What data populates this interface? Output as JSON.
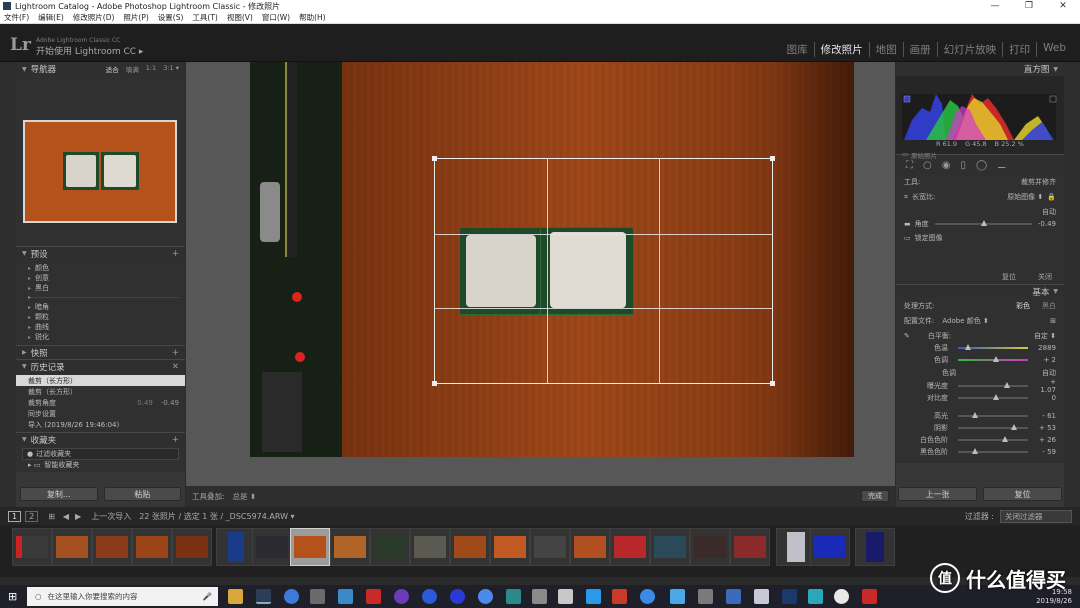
{
  "window": {
    "title": "Lightroom Catalog - Adobe Photoshop Lightroom Classic - 修改照片",
    "controls": [
      "—",
      "❐",
      "✕"
    ]
  },
  "menu": [
    "文件(F)",
    "编辑(E)",
    "修改照片(D)",
    "照片(P)",
    "设置(S)",
    "工具(T)",
    "视图(V)",
    "窗口(W)",
    "帮助(H)"
  ],
  "identity": {
    "logo": "Lr",
    "sub": "Adobe Lightroom Classic CC",
    "main": "开始使用 Lightroom CC ▸"
  },
  "modules": [
    "图库",
    "修改照片",
    "地图",
    "画册",
    "幻灯片放映",
    "打印",
    "Web"
  ],
  "active_module": "修改照片",
  "left": {
    "navigator": {
      "title": "导航器",
      "opts": [
        "适合",
        "填满",
        "1:1",
        "3:1 ▾"
      ]
    },
    "presets": {
      "title": "预设",
      "groups_a": [
        "颜色",
        "创意",
        "黑白"
      ],
      "groups_b": [
        "暗角",
        "颗粒",
        "曲线",
        "锐化"
      ]
    },
    "snapshots": {
      "title": "快照"
    },
    "history": {
      "title": "历史记录",
      "items": [
        {
          "label": "裁剪（长方形）",
          "a": "",
          "b": ""
        },
        {
          "label": "裁剪（长方形）",
          "a": "",
          "b": ""
        },
        {
          "label": "裁剪角度",
          "a": "0.49",
          "b": "-0.49"
        },
        {
          "label": "同步设置",
          "a": "",
          "b": ""
        },
        {
          "label": "导入 (2019/8/26 19:46:04)",
          "a": "",
          "b": ""
        }
      ]
    },
    "collections": {
      "title": "收藏夹",
      "filter": "过滤收藏夹",
      "smart": "智能收藏夹"
    },
    "copy_btn": "复制...",
    "paste_btn": "粘贴"
  },
  "toolbar": {
    "label": "工具叠加:",
    "value": "总是 ⬍",
    "done": "完成"
  },
  "right": {
    "histogram": {
      "title": "直方图",
      "r": "R 61.9",
      "g": "G 45.8",
      "b": "B 25.2 %",
      "orig": "原始照片"
    },
    "crop": {
      "tool_label": "工具:",
      "tool_value": "裁剪并修齐",
      "aspect_label": "长宽比:",
      "aspect_value": "原始图像 ⬍",
      "auto": "自动",
      "angle_label": "角度",
      "angle_value": "-0.49",
      "lock": "锁定图像",
      "reset": "复位",
      "close": "关闭"
    },
    "basic": {
      "title": "基本",
      "treat_label": "处理方式:",
      "treat_color": "彩色",
      "treat_bw": "黑白",
      "profile_label": "配置文件:",
      "profile_value": "Adobe 颜色 ⬍",
      "wb_label": "白平衡:",
      "wb_value": "自定 ⬍",
      "temp_label": "色温",
      "temp_value": "2889",
      "tint_label": "色调",
      "tint_value": "+ 2",
      "tone_label": "色调",
      "tone_auto": "自动",
      "sliders": [
        {
          "k": "曝光度",
          "v": "+ 1.07",
          "pos": 0.66
        },
        {
          "k": "对比度",
          "v": "0",
          "pos": 0.5
        },
        {
          "k": "高光",
          "v": "- 61",
          "pos": 0.2
        },
        {
          "k": "阴影",
          "v": "+ 53",
          "pos": 0.76
        },
        {
          "k": "白色色阶",
          "v": "+ 26",
          "pos": 0.63
        },
        {
          "k": "黑色色阶",
          "v": "- 59",
          "pos": 0.2
        }
      ]
    },
    "prev_btn": "上一张",
    "reset_btn": "复位"
  },
  "filmbar": {
    "pages": [
      "1",
      "2"
    ],
    "source": "上一次导入",
    "info": "22 张照片 / 选定 1 张 / _DSC5974.ARW ▾",
    "filter_label": "过滤器 :",
    "filter_value": "关闭过滤器"
  },
  "taskbar": {
    "search_placeholder": "在这里输入你要搜索的内容",
    "time": "19:58",
    "date": "2019/8/26"
  },
  "watermark": {
    "icon": "值",
    "text": "什么值得买"
  }
}
